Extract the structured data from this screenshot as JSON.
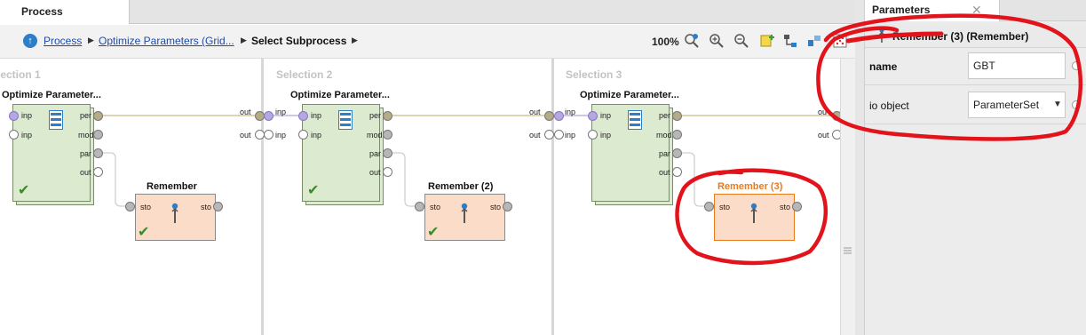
{
  "process_panel": {
    "tab_label": "Process",
    "breadcrumb": [
      {
        "label": "Process"
      },
      {
        "label": "Optimize Parameters (Grid..."
      },
      {
        "label": "Select Subprocess"
      }
    ],
    "zoom": "100%",
    "columns": [
      {
        "title": "lection 1",
        "operator": {
          "title": "Optimize Parameter...",
          "in_ports": [
            "inp",
            "inp"
          ],
          "out_ports": [
            "per",
            "mod",
            "par",
            "out"
          ]
        },
        "remember": {
          "title": "Remember",
          "in_port": "sto",
          "out_port": "sto",
          "selected": false,
          "checked": true
        },
        "out_ports": [
          "out",
          "out"
        ]
      },
      {
        "title": "Selection 2",
        "in_ports": [
          "inp",
          "inp"
        ],
        "operator": {
          "title": "Optimize Parameter...",
          "in_ports": [
            "inp",
            "inp"
          ],
          "out_ports": [
            "per",
            "mod",
            "par",
            "out"
          ]
        },
        "remember": {
          "title": "Remember (2)",
          "in_port": "sto",
          "out_port": "sto",
          "selected": false,
          "checked": true
        },
        "out_ports": [
          "out",
          "out"
        ]
      },
      {
        "title": "Selection 3",
        "in_ports": [
          "inp",
          "inp"
        ],
        "operator": {
          "title": "Optimize Parameter...",
          "in_ports": [
            "inp",
            "inp"
          ],
          "out_ports": [
            "per",
            "mod",
            "par",
            "out"
          ]
        },
        "remember": {
          "title": "Remember (3)",
          "in_port": "sto",
          "out_port": "sto",
          "selected": true,
          "checked": false
        },
        "out_ports": [
          "ou",
          "out"
        ]
      }
    ]
  },
  "parameters_panel": {
    "tab_label": "Parameters",
    "close_glyph": "✕",
    "operator_title": "Remember (3) (Remember)",
    "params": [
      {
        "label": "name",
        "value": "GBT"
      },
      {
        "label": "io object",
        "value": "ParameterSet"
      }
    ]
  },
  "colors": {
    "accent_orange": "#e97a1d",
    "link_blue": "#1f4ba8",
    "annotation_red": "#e3131b"
  }
}
